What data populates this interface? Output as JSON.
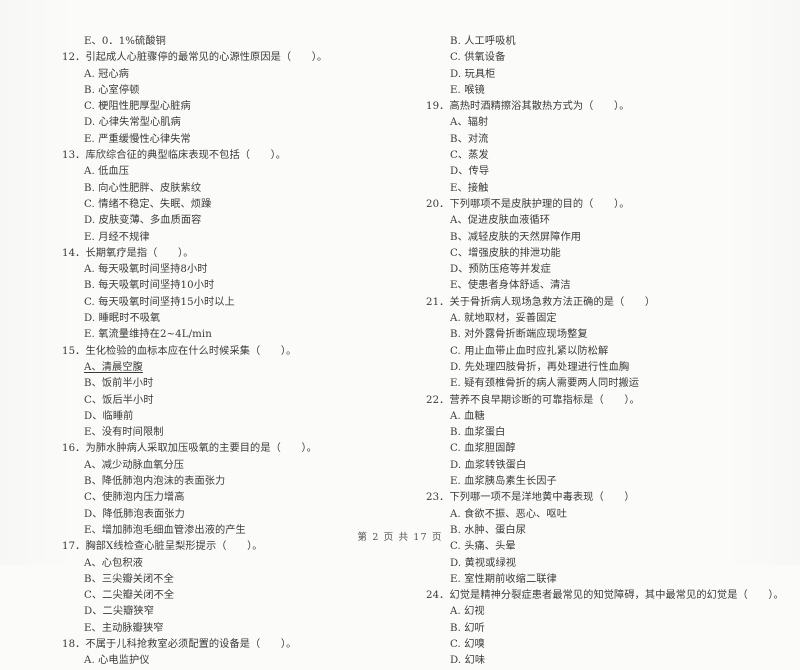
{
  "document": {
    "type": "exam-paper",
    "language": "zh-CN",
    "footer": "第 2 页 共 17 页"
  },
  "left_column": {
    "orphan_line": "E、0．1%硫酸铜",
    "questions": [
      {
        "number": "12",
        "stem": "12．引起成人心脏骤停的最常见的心源性原因是（　　）。",
        "options": [
          {
            "text": "A. 冠心病",
            "underlined": false
          },
          {
            "text": "B. 心室停顿",
            "underlined": false
          },
          {
            "text": "C. 梗阻性肥厚型心脏病",
            "underlined": false
          },
          {
            "text": "D. 心律失常型心肌病",
            "underlined": false
          },
          {
            "text": "E. 严重缓慢性心律失常",
            "underlined": false
          }
        ]
      },
      {
        "number": "13",
        "stem": "13．库欣综合征的典型临床表现不包括（　　）。",
        "options": [
          {
            "text": "A. 低血压",
            "underlined": false
          },
          {
            "text": "B. 向心性肥胖、皮肤紫纹",
            "underlined": false
          },
          {
            "text": "C. 情绪不稳定、失眠、烦躁",
            "underlined": false
          },
          {
            "text": "D. 皮肤变薄、多血质面容",
            "underlined": false
          },
          {
            "text": "E. 月经不规律",
            "underlined": false
          }
        ]
      },
      {
        "number": "14",
        "stem": "14．长期氧疗是指（　　）。",
        "options": [
          {
            "text": "A. 每天吸氧时间坚持8小时",
            "underlined": false
          },
          {
            "text": "B. 每天吸氧时间坚持10小时",
            "underlined": false
          },
          {
            "text": "C. 每天吸氧时间坚持15小时以上",
            "underlined": false
          },
          {
            "text": "D. 睡眠时不吸氧",
            "underlined": false
          },
          {
            "text": "E. 氧流量维持在2~4L/min",
            "underlined": false
          }
        ]
      },
      {
        "number": "15",
        "stem": "15．生化检验的血标本应在什么时候采集（　　）。",
        "options": [
          {
            "text": "A、清晨空腹",
            "underlined": true
          },
          {
            "text": "B、饭前半小时",
            "underlined": false
          },
          {
            "text": "C、饭后半小时",
            "underlined": false
          },
          {
            "text": "D、临睡前",
            "underlined": false
          },
          {
            "text": "E、没有时间限制",
            "underlined": false
          }
        ]
      },
      {
        "number": "16",
        "stem": "16．为肺水肿病人采取加压吸氧的主要目的是（　　）。",
        "options": [
          {
            "text": "A、减少动脉血氧分压",
            "underlined": false
          },
          {
            "text": "B、降低肺泡内泡沫的表面张力",
            "underlined": false
          },
          {
            "text": "C、使肺泡内压力增高",
            "underlined": false
          },
          {
            "text": "D、降低肺泡表面张力",
            "underlined": false
          },
          {
            "text": "E、增加肺泡毛细血管渗出液的产生",
            "underlined": false
          }
        ]
      },
      {
        "number": "17",
        "stem": "17．胸部X线检查心脏呈梨形提示（　　）。",
        "options": [
          {
            "text": "A、心包积液",
            "underlined": false
          },
          {
            "text": "B、三尖瓣关闭不全",
            "underlined": false
          },
          {
            "text": "C、二尖瓣关闭不全",
            "underlined": false
          },
          {
            "text": "D、二尖瓣狭窄",
            "underlined": false
          },
          {
            "text": "E、主动脉瓣狭窄",
            "underlined": false
          }
        ]
      },
      {
        "number": "18",
        "stem": "18．不属于儿科抢救室必须配置的设备是（　　）。",
        "options": [
          {
            "text": "A. 心电监护仪",
            "underlined": false
          }
        ]
      }
    ]
  },
  "right_column": {
    "orphan_options": [
      {
        "text": "B. 人工呼吸机",
        "underlined": false
      },
      {
        "text": "C. 供氧设备",
        "underlined": false
      },
      {
        "text": "D. 玩具柜",
        "underlined": false
      },
      {
        "text": "E. 喉镜",
        "underlined": false
      }
    ],
    "questions": [
      {
        "number": "19",
        "stem": "19．高热时酒精擦浴其散热方式为（　　）。",
        "options": [
          {
            "text": "A、辐射",
            "underlined": false
          },
          {
            "text": "B、对流",
            "underlined": false
          },
          {
            "text": "C、蒸发",
            "underlined": false
          },
          {
            "text": "D、传导",
            "underlined": false
          },
          {
            "text": "E、接触",
            "underlined": false
          }
        ]
      },
      {
        "number": "20",
        "stem": "20．下列哪项不是皮肤护理的目的（　　）。",
        "options": [
          {
            "text": "A、促进皮肤血液循环",
            "underlined": false
          },
          {
            "text": "B、减轻皮肤的天然屏障作用",
            "underlined": false
          },
          {
            "text": "C、增强皮肤的排泄功能",
            "underlined": false
          },
          {
            "text": "D、预防压疮等并发症",
            "underlined": false
          },
          {
            "text": "E、使患者身体舒适、清洁",
            "underlined": false
          }
        ]
      },
      {
        "number": "21",
        "stem": "21．关于骨折病人现场急救方法正确的是（　　）",
        "options": [
          {
            "text": "A. 就地取材，妥善固定",
            "underlined": false
          },
          {
            "text": "B. 对外露骨折断端应现场整复",
            "underlined": false
          },
          {
            "text": "C. 用止血带止血时应扎紧以防松解",
            "underlined": false
          },
          {
            "text": "D. 先处理四肢骨折，再处理进行性血胸",
            "underlined": false
          },
          {
            "text": "E. 疑有颈椎骨折的病人需要两人同时搬运",
            "underlined": false
          }
        ]
      },
      {
        "number": "22",
        "stem": "22．营养不良早期诊断的可靠指标是（　　）。",
        "options": [
          {
            "text": "A. 血糖",
            "underlined": false
          },
          {
            "text": "B. 血浆蛋白",
            "underlined": false
          },
          {
            "text": "C. 血浆胆固醇",
            "underlined": false
          },
          {
            "text": "D. 血浆转铁蛋白",
            "underlined": false
          },
          {
            "text": "E. 血浆胰岛素生长因子",
            "underlined": false
          }
        ]
      },
      {
        "number": "23",
        "stem": "23．下列哪一项不是洋地黄中毒表现（　　）",
        "options": [
          {
            "text": "A. 食欲不振、恶心、呕吐",
            "underlined": false
          },
          {
            "text": "B. 水肿、蛋白尿",
            "underlined": false
          },
          {
            "text": "C. 头痛、头晕",
            "underlined": false
          },
          {
            "text": "D. 黄视或绿视",
            "underlined": false
          },
          {
            "text": "E. 室性期前收缩二联律",
            "underlined": false
          }
        ]
      },
      {
        "number": "24",
        "stem": "24．幻觉是精神分裂症患者最常见的知觉障碍，其中最常见的幻觉是（　　）。",
        "options": [
          {
            "text": "A. 幻视",
            "underlined": false
          },
          {
            "text": "B. 幻听",
            "underlined": false
          },
          {
            "text": "C. 幻嗅",
            "underlined": false
          },
          {
            "text": "D. 幻味",
            "underlined": false
          }
        ]
      }
    ]
  }
}
